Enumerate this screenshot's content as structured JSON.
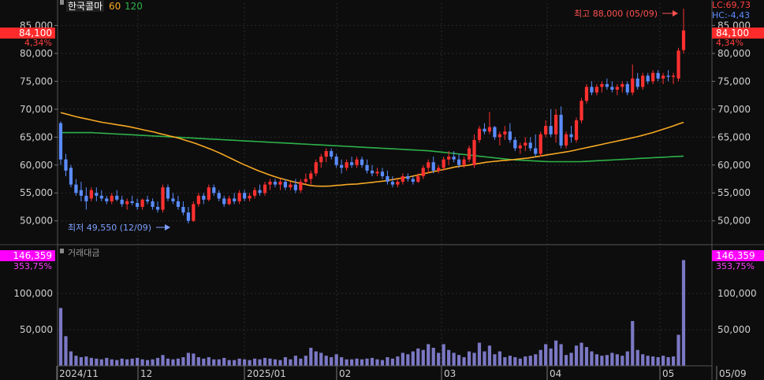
{
  "stock": {
    "name": "한국콜마",
    "ma_labels": [
      {
        "label": "60",
        "color": "#f7a823"
      },
      {
        "label": "120",
        "color": "#2db24a"
      }
    ]
  },
  "right_info": {
    "lc": "LC:69,73",
    "hc": "HC:-4,43"
  },
  "current_price": {
    "value": "84,100",
    "change_pct": "4,34%",
    "color": "#ff2b2b"
  },
  "current_volume": {
    "value": "146,359",
    "ratio": "353,75%",
    "color": "#ff00ff"
  },
  "annotations": {
    "high": "최고 88,000 (05/09)",
    "low": "최저 49,550 (12/09)"
  },
  "volume_title": "거래대금",
  "x_axis_labels": [
    "2024/11",
    "12",
    "2025/01",
    "02",
    "03",
    "04",
    "05",
    "05/09"
  ],
  "price_axis_labels": [
    "85,000",
    "80,000",
    "75,000",
    "70,000",
    "65,000",
    "60,000",
    "55,000",
    "50,000"
  ],
  "volume_axis_labels": [
    "100,000",
    "50,000"
  ],
  "colors": {
    "up": "#ff3030",
    "down": "#5b8cff",
    "ma60": "#f7a823",
    "ma120": "#2db24a",
    "volume": "#7b78c4",
    "grid": "#2a2a2a",
    "text": "#cfcfcf"
  },
  "chart_data": {
    "type": "candlestick",
    "price_range": [
      47000,
      89000
    ],
    "volume_range": [
      0,
      160000
    ],
    "candles": [
      {
        "o": 67500,
        "h": 67800,
        "l": 60000,
        "c": 61000,
        "v": 80000
      },
      {
        "o": 61000,
        "h": 62000,
        "l": 58000,
        "c": 59000,
        "v": 41000
      },
      {
        "o": 59500,
        "h": 60000,
        "l": 56000,
        "c": 56500,
        "v": 20000
      },
      {
        "o": 56500,
        "h": 57500,
        "l": 54500,
        "c": 55000,
        "v": 14000
      },
      {
        "o": 55500,
        "h": 57000,
        "l": 53500,
        "c": 54500,
        "v": 12000
      },
      {
        "o": 54500,
        "h": 56000,
        "l": 52000,
        "c": 53500,
        "v": 13000
      },
      {
        "o": 54000,
        "h": 56000,
        "l": 53500,
        "c": 55500,
        "v": 11000
      },
      {
        "o": 55000,
        "h": 56000,
        "l": 53500,
        "c": 54500,
        "v": 10000
      },
      {
        "o": 54500,
        "h": 55500,
        "l": 53500,
        "c": 54000,
        "v": 9000
      },
      {
        "o": 54000,
        "h": 54500,
        "l": 53000,
        "c": 53500,
        "v": 11000
      },
      {
        "o": 53500,
        "h": 55000,
        "l": 53000,
        "c": 54500,
        "v": 9000
      },
      {
        "o": 54500,
        "h": 55500,
        "l": 53500,
        "c": 53800,
        "v": 8000
      },
      {
        "o": 53800,
        "h": 54500,
        "l": 52500,
        "c": 53000,
        "v": 10000
      },
      {
        "o": 53000,
        "h": 54000,
        "l": 52000,
        "c": 53500,
        "v": 9000
      },
      {
        "o": 53500,
        "h": 54500,
        "l": 52800,
        "c": 53200,
        "v": 10000
      },
      {
        "o": 53200,
        "h": 54000,
        "l": 52000,
        "c": 52500,
        "v": 11000
      },
      {
        "o": 52500,
        "h": 54000,
        "l": 52000,
        "c": 53800,
        "v": 9000
      },
      {
        "o": 53800,
        "h": 54500,
        "l": 53000,
        "c": 53500,
        "v": 8000
      },
      {
        "o": 53500,
        "h": 54000,
        "l": 52000,
        "c": 52500,
        "v": 9000
      },
      {
        "o": 52500,
        "h": 53500,
        "l": 51500,
        "c": 52000,
        "v": 11000
      },
      {
        "o": 52000,
        "h": 56500,
        "l": 51500,
        "c": 56000,
        "v": 15000
      },
      {
        "o": 56000,
        "h": 56500,
        "l": 53500,
        "c": 54000,
        "v": 10000
      },
      {
        "o": 54000,
        "h": 55000,
        "l": 53000,
        "c": 53500,
        "v": 9000
      },
      {
        "o": 53500,
        "h": 54500,
        "l": 52000,
        "c": 52500,
        "v": 10000
      },
      {
        "o": 52500,
        "h": 53500,
        "l": 51000,
        "c": 51500,
        "v": 12000
      },
      {
        "o": 51500,
        "h": 52500,
        "l": 49550,
        "c": 50000,
        "v": 18000
      },
      {
        "o": 50000,
        "h": 53500,
        "l": 49800,
        "c": 53000,
        "v": 17000
      },
      {
        "o": 53000,
        "h": 55000,
        "l": 52500,
        "c": 54500,
        "v": 12000
      },
      {
        "o": 54500,
        "h": 55000,
        "l": 53000,
        "c": 53800,
        "v": 10000
      },
      {
        "o": 53800,
        "h": 56500,
        "l": 53500,
        "c": 56000,
        "v": 12000
      },
      {
        "o": 56000,
        "h": 56500,
        "l": 54500,
        "c": 55000,
        "v": 9000
      },
      {
        "o": 55000,
        "h": 55500,
        "l": 53500,
        "c": 54000,
        "v": 9000
      },
      {
        "o": 54000,
        "h": 54500,
        "l": 52500,
        "c": 53000,
        "v": 11000
      },
      {
        "o": 53000,
        "h": 54500,
        "l": 52800,
        "c": 54000,
        "v": 8000
      },
      {
        "o": 54000,
        "h": 55000,
        "l": 53000,
        "c": 53500,
        "v": 8000
      },
      {
        "o": 53500,
        "h": 55500,
        "l": 53000,
        "c": 55000,
        "v": 10000
      },
      {
        "o": 55000,
        "h": 55500,
        "l": 53500,
        "c": 54000,
        "v": 9000
      },
      {
        "o": 54000,
        "h": 55000,
        "l": 53500,
        "c": 54500,
        "v": 8000
      },
      {
        "o": 54500,
        "h": 56000,
        "l": 54000,
        "c": 55500,
        "v": 10000
      },
      {
        "o": 55500,
        "h": 56500,
        "l": 54500,
        "c": 55000,
        "v": 9000
      },
      {
        "o": 55000,
        "h": 57000,
        "l": 54500,
        "c": 56500,
        "v": 11000
      },
      {
        "o": 56500,
        "h": 57500,
        "l": 55500,
        "c": 57000,
        "v": 10000
      },
      {
        "o": 57000,
        "h": 57500,
        "l": 56000,
        "c": 56500,
        "v": 9000
      },
      {
        "o": 56500,
        "h": 57500,
        "l": 55500,
        "c": 57000,
        "v": 8000
      },
      {
        "o": 57000,
        "h": 57500,
        "l": 55500,
        "c": 56000,
        "v": 12000
      },
      {
        "o": 56000,
        "h": 57000,
        "l": 55500,
        "c": 56500,
        "v": 9000
      },
      {
        "o": 56500,
        "h": 57500,
        "l": 55000,
        "c": 55500,
        "v": 14000
      },
      {
        "o": 55500,
        "h": 57500,
        "l": 55000,
        "c": 57000,
        "v": 10000
      },
      {
        "o": 57000,
        "h": 58500,
        "l": 56500,
        "c": 57500,
        "v": 14000
      },
      {
        "o": 57500,
        "h": 59000,
        "l": 56500,
        "c": 58500,
        "v": 25000
      },
      {
        "o": 58500,
        "h": 61000,
        "l": 58000,
        "c": 60500,
        "v": 20000
      },
      {
        "o": 60500,
        "h": 62000,
        "l": 59500,
        "c": 61500,
        "v": 18000
      },
      {
        "o": 61500,
        "h": 63000,
        "l": 60500,
        "c": 62500,
        "v": 14000
      },
      {
        "o": 62500,
        "h": 63000,
        "l": 61000,
        "c": 61500,
        "v": 12000
      },
      {
        "o": 61500,
        "h": 62000,
        "l": 59500,
        "c": 60000,
        "v": 16000
      },
      {
        "o": 60000,
        "h": 61000,
        "l": 58500,
        "c": 59500,
        "v": 12000
      },
      {
        "o": 59500,
        "h": 61000,
        "l": 59000,
        "c": 60500,
        "v": 9000
      },
      {
        "o": 60500,
        "h": 61500,
        "l": 59500,
        "c": 60000,
        "v": 9000
      },
      {
        "o": 60000,
        "h": 61500,
        "l": 59500,
        "c": 61000,
        "v": 10000
      },
      {
        "o": 61000,
        "h": 61500,
        "l": 59500,
        "c": 60000,
        "v": 9000
      },
      {
        "o": 60000,
        "h": 61000,
        "l": 58500,
        "c": 59000,
        "v": 10000
      },
      {
        "o": 59000,
        "h": 60000,
        "l": 58000,
        "c": 58500,
        "v": 11000
      },
      {
        "o": 58500,
        "h": 59500,
        "l": 58000,
        "c": 58800,
        "v": 9000
      },
      {
        "o": 58800,
        "h": 59500,
        "l": 57500,
        "c": 58000,
        "v": 8000
      },
      {
        "o": 58000,
        "h": 59000,
        "l": 56500,
        "c": 57000,
        "v": 12000
      },
      {
        "o": 57000,
        "h": 58000,
        "l": 56000,
        "c": 56500,
        "v": 10000
      },
      {
        "o": 56500,
        "h": 57500,
        "l": 56000,
        "c": 57000,
        "v": 13000
      },
      {
        "o": 57000,
        "h": 58500,
        "l": 56500,
        "c": 58000,
        "v": 18000
      },
      {
        "o": 58000,
        "h": 58500,
        "l": 57000,
        "c": 57500,
        "v": 16000
      },
      {
        "o": 57500,
        "h": 58000,
        "l": 56500,
        "c": 57000,
        "v": 20000
      },
      {
        "o": 57000,
        "h": 58500,
        "l": 56800,
        "c": 58000,
        "v": 24000
      },
      {
        "o": 58000,
        "h": 60000,
        "l": 57500,
        "c": 59500,
        "v": 22000
      },
      {
        "o": 59500,
        "h": 61000,
        "l": 58500,
        "c": 60500,
        "v": 30000
      },
      {
        "o": 60500,
        "h": 61500,
        "l": 58500,
        "c": 59000,
        "v": 25000
      },
      {
        "o": 59000,
        "h": 60000,
        "l": 58500,
        "c": 59500,
        "v": 18000
      },
      {
        "o": 59500,
        "h": 61500,
        "l": 59000,
        "c": 61000,
        "v": 30000
      },
      {
        "o": 61000,
        "h": 62500,
        "l": 60000,
        "c": 61500,
        "v": 22000
      },
      {
        "o": 61500,
        "h": 62500,
        "l": 60500,
        "c": 61000,
        "v": 18000
      },
      {
        "o": 61000,
        "h": 62000,
        "l": 59500,
        "c": 60000,
        "v": 15000
      },
      {
        "o": 60000,
        "h": 61500,
        "l": 59500,
        "c": 61000,
        "v": 12000
      },
      {
        "o": 61000,
        "h": 63500,
        "l": 60500,
        "c": 63000,
        "v": 20000
      },
      {
        "o": 60000,
        "h": 65500,
        "l": 59500,
        "c": 64500,
        "v": 18000
      },
      {
        "o": 64500,
        "h": 67000,
        "l": 64000,
        "c": 66500,
        "v": 32000
      },
      {
        "o": 66500,
        "h": 67500,
        "l": 65500,
        "c": 66000,
        "v": 20000
      },
      {
        "o": 66000,
        "h": 69500,
        "l": 65500,
        "c": 66800,
        "v": 28000
      },
      {
        "o": 66800,
        "h": 67000,
        "l": 64500,
        "c": 65000,
        "v": 16000
      },
      {
        "o": 65000,
        "h": 66000,
        "l": 63500,
        "c": 65500,
        "v": 20000
      },
      {
        "o": 65500,
        "h": 67000,
        "l": 64500,
        "c": 66000,
        "v": 12000
      },
      {
        "o": 66000,
        "h": 67500,
        "l": 64000,
        "c": 64500,
        "v": 14000
      },
      {
        "o": 64500,
        "h": 65000,
        "l": 62500,
        "c": 63000,
        "v": 12000
      },
      {
        "o": 63000,
        "h": 64000,
        "l": 62000,
        "c": 63500,
        "v": 10000
      },
      {
        "o": 63500,
        "h": 65000,
        "l": 62500,
        "c": 64000,
        "v": 13000
      },
      {
        "o": 64000,
        "h": 65000,
        "l": 62500,
        "c": 63000,
        "v": 14000
      },
      {
        "o": 63000,
        "h": 65500,
        "l": 61500,
        "c": 62000,
        "v": 16000
      },
      {
        "o": 62000,
        "h": 66000,
        "l": 61500,
        "c": 65500,
        "v": 22000
      },
      {
        "o": 65500,
        "h": 68000,
        "l": 65000,
        "c": 67000,
        "v": 30000
      },
      {
        "o": 67000,
        "h": 70000,
        "l": 65000,
        "c": 65500,
        "v": 24000
      },
      {
        "o": 65500,
        "h": 70000,
        "l": 64000,
        "c": 69000,
        "v": 35000
      },
      {
        "o": 69000,
        "h": 70500,
        "l": 63000,
        "c": 63500,
        "v": 30000
      },
      {
        "o": 63500,
        "h": 66000,
        "l": 63000,
        "c": 65500,
        "v": 15000
      },
      {
        "o": 65500,
        "h": 67000,
        "l": 64000,
        "c": 65000,
        "v": 18000
      },
      {
        "o": 64500,
        "h": 68500,
        "l": 64000,
        "c": 68000,
        "v": 28000
      },
      {
        "o": 68000,
        "h": 72000,
        "l": 67500,
        "c": 71500,
        "v": 32000
      },
      {
        "o": 71500,
        "h": 74500,
        "l": 71000,
        "c": 74000,
        "v": 26000
      },
      {
        "o": 74000,
        "h": 75000,
        "l": 72500,
        "c": 73000,
        "v": 20000
      },
      {
        "o": 73000,
        "h": 74500,
        "l": 72500,
        "c": 74000,
        "v": 16000
      },
      {
        "o": 74000,
        "h": 75000,
        "l": 73000,
        "c": 74500,
        "v": 14000
      },
      {
        "o": 74500,
        "h": 75500,
        "l": 73500,
        "c": 74000,
        "v": 15000
      },
      {
        "o": 74000,
        "h": 75000,
        "l": 73000,
        "c": 73500,
        "v": 18000
      },
      {
        "o": 73500,
        "h": 74500,
        "l": 72500,
        "c": 74000,
        "v": 16000
      },
      {
        "o": 74000,
        "h": 75000,
        "l": 73000,
        "c": 74500,
        "v": 14000
      },
      {
        "o": 74500,
        "h": 75000,
        "l": 72500,
        "c": 73000,
        "v": 20000
      },
      {
        "o": 73000,
        "h": 78000,
        "l": 72500,
        "c": 75500,
        "v": 62000
      },
      {
        "o": 75500,
        "h": 76500,
        "l": 73500,
        "c": 74000,
        "v": 22000
      },
      {
        "o": 74000,
        "h": 76500,
        "l": 73500,
        "c": 76000,
        "v": 16000
      },
      {
        "o": 76000,
        "h": 76500,
        "l": 74500,
        "c": 75000,
        "v": 14000
      },
      {
        "o": 75000,
        "h": 77000,
        "l": 74500,
        "c": 76500,
        "v": 13000
      },
      {
        "o": 76500,
        "h": 77000,
        "l": 75000,
        "c": 75500,
        "v": 12000
      },
      {
        "o": 75500,
        "h": 76500,
        "l": 74500,
        "c": 76000,
        "v": 14000
      },
      {
        "o": 76000,
        "h": 77000,
        "l": 75000,
        "c": 75800,
        "v": 12000
      },
      {
        "o": 75800,
        "h": 76500,
        "l": 74500,
        "c": 76000,
        "v": 13000
      },
      {
        "o": 75500,
        "h": 81000,
        "l": 75000,
        "c": 80500,
        "v": 43000
      },
      {
        "o": 80600,
        "h": 88000,
        "l": 80000,
        "c": 84100,
        "v": 146359
      }
    ],
    "ma60": [
      69400,
      69150,
      68900,
      68650,
      68450,
      68250,
      68050,
      67850,
      67650,
      67500,
      67350,
      67200,
      67050,
      66900,
      66700,
      66500,
      66300,
      66100,
      65900,
      65650,
      65450,
      65200,
      65000,
      64750,
      64450,
      64150,
      63850,
      63500,
      63150,
      62800,
      62400,
      62000,
      61550,
      61100,
      60650,
      60200,
      59800,
      59400,
      59000,
      58650,
      58300,
      58000,
      57700,
      57450,
      57200,
      56950,
      56750,
      56550,
      56350,
      56250,
      56200,
      56200,
      56250,
      56350,
      56400,
      56500,
      56550,
      56600,
      56700,
      56800,
      56900,
      57000,
      57100,
      57250,
      57400,
      57550,
      57700,
      57850,
      58050,
      58250,
      58450,
      58650,
      58850,
      59050,
      59250,
      59450,
      59650,
      59800,
      59900,
      60050,
      60200,
      60350,
      60500,
      60600,
      60700,
      60800,
      60850,
      60950,
      61050,
      61150,
      61250,
      61400,
      61550,
      61700,
      61850,
      62000,
      62150,
      62300,
      62450,
      62650,
      62850,
      63050,
      63250,
      63450,
      63650,
      63850,
      64050,
      64250,
      64450,
      64650,
      64850,
      65050,
      65300,
      65550,
      65800,
      66100,
      66400,
      66700,
      67000,
      67350,
      67650
    ],
    "ma120": [
      65800,
      65800,
      65800,
      65800,
      65800,
      65800,
      65800,
      65750,
      65700,
      65650,
      65600,
      65550,
      65500,
      65450,
      65400,
      65350,
      65300,
      65250,
      65200,
      65150,
      65100,
      65050,
      65000,
      64950,
      64900,
      64850,
      64800,
      64750,
      64700,
      64650,
      64600,
      64550,
      64500,
      64450,
      64400,
      64350,
      64300,
      64250,
      64200,
      64150,
      64100,
      64050,
      64000,
      63950,
      63900,
      63850,
      63800,
      63750,
      63700,
      63650,
      63600,
      63550,
      63500,
      63450,
      63400,
      63350,
      63300,
      63250,
      63200,
      63150,
      63100,
      63050,
      63000,
      62950,
      62900,
      62850,
      62800,
      62750,
      62700,
      62650,
      62600,
      62550,
      62450,
      62350,
      62250,
      62150,
      62050,
      61950,
      61850,
      61750,
      61650,
      61550,
      61450,
      61350,
      61250,
      61150,
      61050,
      60950,
      60900,
      60850,
      60800,
      60750,
      60700,
      60650,
      60600,
      60600,
      60600,
      60600,
      60600,
      60600,
      60600,
      60650,
      60700,
      60750,
      60800,
      60850,
      60900,
      60950,
      61000,
      61050,
      61100,
      61150,
      61200,
      61250,
      61300,
      61350,
      61400,
      61450,
      61500,
      61550,
      61600
    ]
  }
}
